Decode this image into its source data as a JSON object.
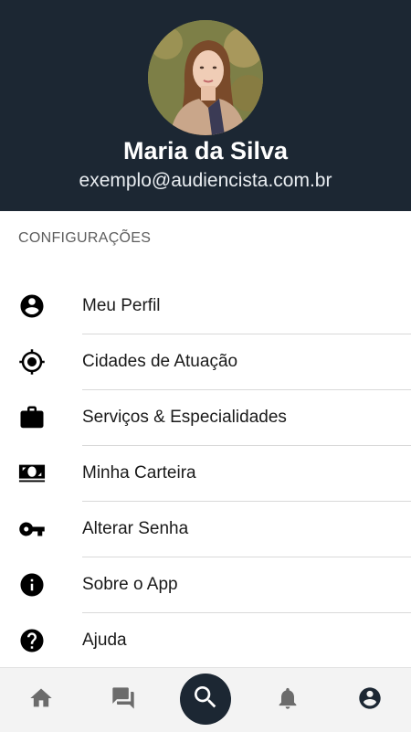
{
  "profile": {
    "name": "Maria da Silva",
    "email": "exemplo@audiencista.com.br"
  },
  "settings": {
    "section_title": "CONFIGURAÇÕES",
    "items": [
      {
        "label": "Meu Perfil",
        "icon": "account-circle-icon"
      },
      {
        "label": "Cidades de Atuação",
        "icon": "gps-target-icon"
      },
      {
        "label": "Serviços & Especialidades",
        "icon": "briefcase-icon"
      },
      {
        "label": "Minha Carteira",
        "icon": "money-icon"
      },
      {
        "label": "Alterar Senha",
        "icon": "key-icon"
      },
      {
        "label": "Sobre o App",
        "icon": "info-icon"
      },
      {
        "label": "Ajuda",
        "icon": "help-icon"
      }
    ]
  },
  "bottom_nav": {
    "items": [
      "home-icon",
      "chat-icon",
      "search-icon",
      "bell-icon",
      "account-icon"
    ],
    "active": "account-icon"
  },
  "colors": {
    "header_bg": "#1c2733",
    "nav_bg": "#f3f3f3",
    "icon_inactive": "#6b6b6b",
    "icon_active": "#1c2733"
  }
}
